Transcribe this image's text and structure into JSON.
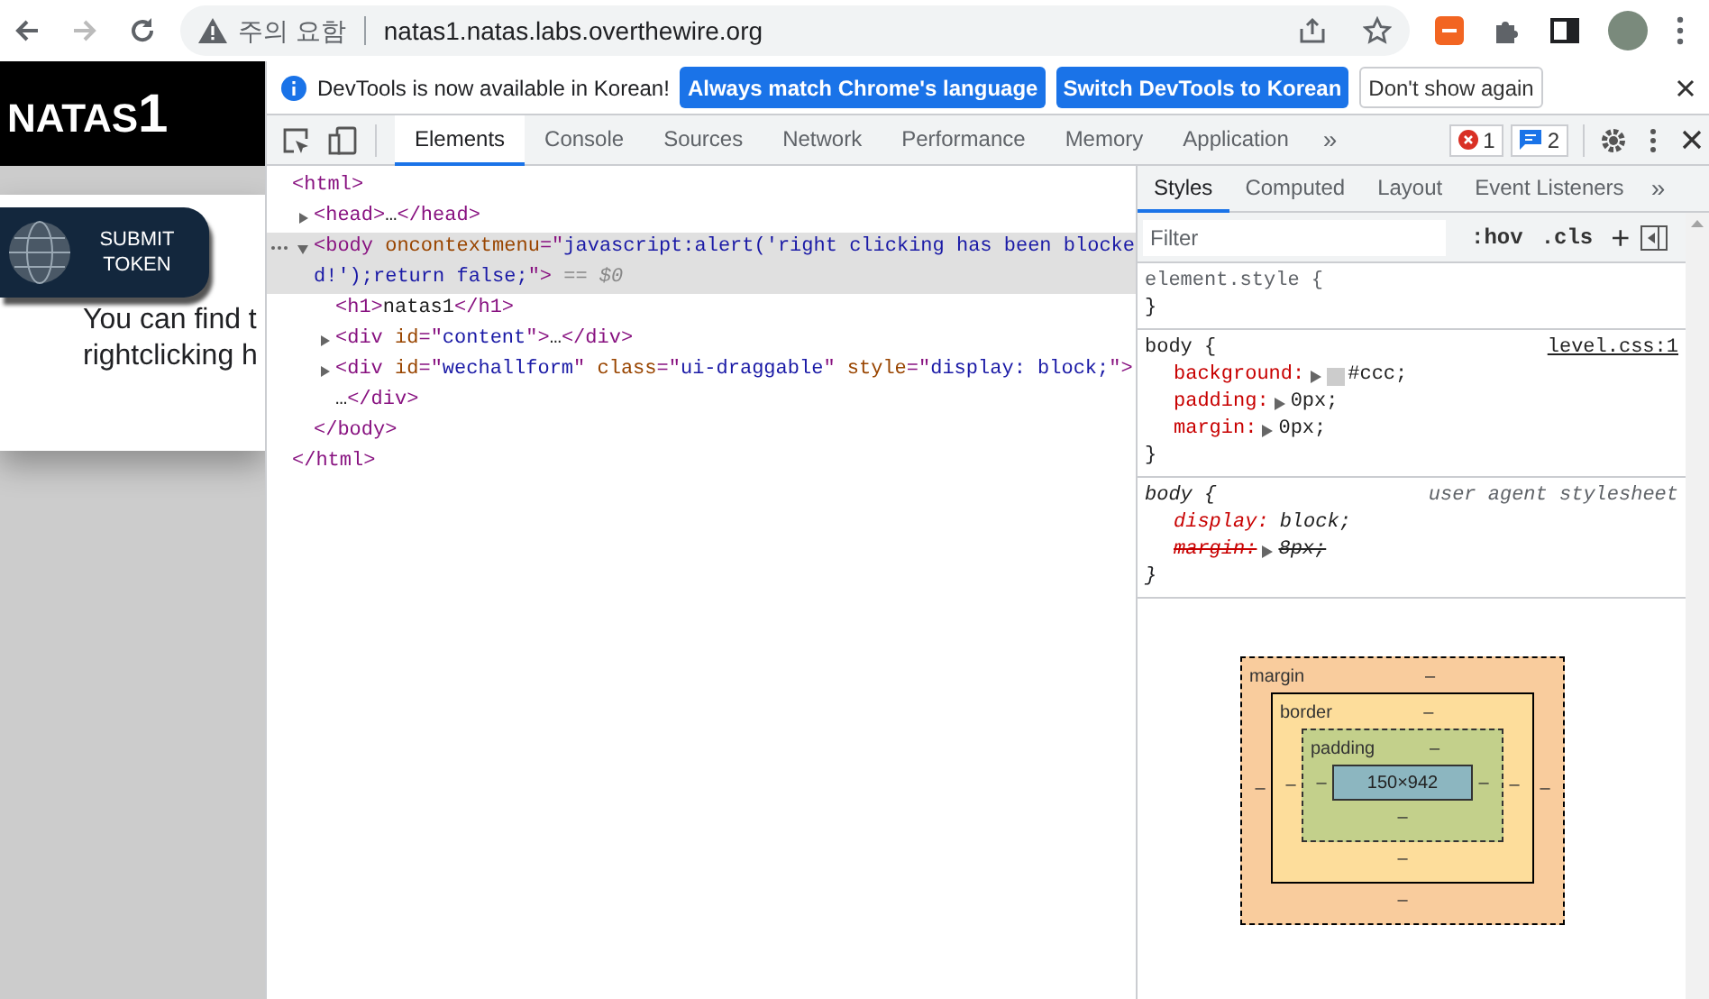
{
  "browser": {
    "security_label": "주의 요함",
    "url": "natas1.natas.labs.overthewire.org",
    "back_disabled": false,
    "forward_disabled": true
  },
  "page": {
    "logo_main": "NATAS",
    "logo_number": "1",
    "submit_button": "SUBMIT TOKEN",
    "lines": [
      "You can find t",
      "rightclicking h"
    ]
  },
  "infobar": {
    "message": "DevTools is now available in Korean!",
    "buttons": [
      {
        "label": "Always match Chrome's language",
        "kind": "primary"
      },
      {
        "label": "Switch DevTools to Korean",
        "kind": "primary"
      },
      {
        "label": "Don't show again",
        "kind": "secondary"
      }
    ]
  },
  "devtools_tabs": [
    {
      "label": "Elements",
      "selected": true
    },
    {
      "label": "Console",
      "selected": false
    },
    {
      "label": "Sources",
      "selected": false
    },
    {
      "label": "Network",
      "selected": false
    },
    {
      "label": "Performance",
      "selected": false
    },
    {
      "label": "Memory",
      "selected": false
    },
    {
      "label": "Application",
      "selected": false
    }
  ],
  "more_tabs": "»",
  "error_count": "1",
  "message_count": "2",
  "dom_tree": [
    {
      "selected": false,
      "segments": [
        {
          "kind": "tag",
          "text": "<html>"
        }
      ],
      "children": [
        {
          "expanded": false,
          "selected": false,
          "segments": [
            {
              "kind": "tag",
              "text": "<head>"
            },
            {
              "kind": "text",
              "text": "…"
            },
            {
              "kind": "tag",
              "text": "</head>"
            }
          ]
        },
        {
          "expanded": true,
          "selected": true,
          "segments": [
            {
              "kind": "tag",
              "text": "<body "
            },
            {
              "kind": "attr",
              "text": "oncontextmenu"
            },
            {
              "kind": "tag",
              "text": "=\""
            },
            {
              "kind": "value",
              "text": "javascript:alert('right clicking has been blocke"
            }
          ],
          "continuation": [
            {
              "kind": "value",
              "text": "d!');return false;"
            },
            {
              "kind": "tag",
              "text": "\">"
            },
            {
              "kind": "note",
              "text": " == $0"
            }
          ],
          "children": [
            {
              "selected": false,
              "segments": [
                {
                  "kind": "tag",
                  "text": "<h1>"
                },
                {
                  "kind": "text",
                  "text": "natas1"
                },
                {
                  "kind": "tag",
                  "text": "</h1>"
                }
              ]
            },
            {
              "expanded": false,
              "selected": false,
              "segments": [
                {
                  "kind": "tag",
                  "text": "<div "
                },
                {
                  "kind": "attr",
                  "text": "id"
                },
                {
                  "kind": "tag",
                  "text": "=\""
                },
                {
                  "kind": "value",
                  "text": "content"
                },
                {
                  "kind": "tag",
                  "text": "\">"
                },
                {
                  "kind": "text",
                  "text": "…"
                },
                {
                  "kind": "tag",
                  "text": "</div>"
                }
              ]
            },
            {
              "expanded": false,
              "selected": false,
              "segments": [
                {
                  "kind": "tag",
                  "text": "<div "
                },
                {
                  "kind": "attr",
                  "text": "id"
                },
                {
                  "kind": "tag",
                  "text": "=\""
                },
                {
                  "kind": "value",
                  "text": "wechallform"
                },
                {
                  "kind": "tag",
                  "text": "\" "
                },
                {
                  "kind": "attr",
                  "text": "class"
                },
                {
                  "kind": "tag",
                  "text": "=\""
                },
                {
                  "kind": "value",
                  "text": "ui-draggable"
                },
                {
                  "kind": "tag",
                  "text": "\" "
                },
                {
                  "kind": "attr",
                  "text": "style"
                },
                {
                  "kind": "tag",
                  "text": "=\""
                },
                {
                  "kind": "value",
                  "text": "display: block;"
                },
                {
                  "kind": "tag",
                  "text": "\">"
                }
              ],
              "continuation": [
                {
                  "kind": "text",
                  "text": "…"
                },
                {
                  "kind": "tag",
                  "text": "</div>"
                }
              ]
            }
          ],
          "closing": [
            {
              "kind": "tag",
              "text": "</body>"
            }
          ]
        }
      ],
      "closing": [
        {
          "kind": "tag",
          "text": "</html>"
        }
      ]
    }
  ],
  "styles_tabs": [
    {
      "label": "Styles",
      "selected": true
    },
    {
      "label": "Computed",
      "selected": false
    },
    {
      "label": "Layout",
      "selected": false
    },
    {
      "label": "Event Listeners",
      "selected": false
    }
  ],
  "styles_more": "»",
  "filter": {
    "placeholder": "Filter",
    "hov": ":hov",
    "cls": ".cls",
    "add": "+"
  },
  "rules": [
    {
      "kind": "inline",
      "selector": "element.style {",
      "close": "}"
    },
    {
      "kind": "author",
      "selector": "body {",
      "source": "level.css:1",
      "close": "}",
      "properties": [
        {
          "name": "background:",
          "value": "#ccc;",
          "expandable": true,
          "color": "#cccccc",
          "struck": false
        },
        {
          "name": "padding:",
          "value": "0px;",
          "expandable": true,
          "struck": false
        },
        {
          "name": "margin:",
          "value": "0px;",
          "expandable": true,
          "struck": false
        }
      ]
    },
    {
      "kind": "user_agent",
      "selector": "body {",
      "source": "user agent stylesheet",
      "close": "}",
      "properties": [
        {
          "name": "display:",
          "value": "block;",
          "expandable": false,
          "struck": false
        },
        {
          "name": "margin:",
          "value": "8px;",
          "expandable": true,
          "struck": true
        }
      ]
    }
  ],
  "box_model": {
    "kind": "margin",
    "label": "margin",
    "top": "–",
    "left": "–",
    "inner": {
      "kind": "border",
      "label": "border",
      "top": "–",
      "left": "–",
      "inner": {
        "kind": "padding",
        "label": "padding",
        "top": "–",
        "left": "–",
        "content": "150×942",
        "right": "–",
        "bottom": "–"
      },
      "right": "–",
      "bottom": "–"
    },
    "right": "–",
    "bottom": "–"
  }
}
